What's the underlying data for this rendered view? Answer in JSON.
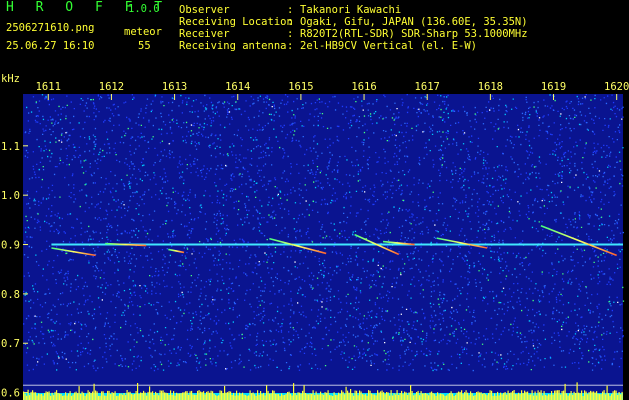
{
  "header": {
    "app_name": "H R O F F T",
    "version": "1.0.0",
    "filename": "2506271610.png",
    "datetime": "25.06.27 16:10",
    "meteor_label": "meteor",
    "meteor_count": "55",
    "info": [
      {
        "label": "Observer",
        "value": "Takanori Kawachi"
      },
      {
        "label": "Receiving Location",
        "value": "Ogaki, Gifu, JAPAN (136.60E, 35.35N)"
      },
      {
        "label": "Receiver",
        "value": "R820T2(RTL-SDR) SDR-Sharp 53.1000MHz"
      },
      {
        "label": "Receiving antenna",
        "value": "2el-HB9CV Vertical (el. E-W)"
      }
    ],
    "separator": ":"
  },
  "chart_data": {
    "type": "heatmap",
    "ylabel": "kHz",
    "x_ticks": [
      "1611",
      "1612",
      "1613",
      "1614",
      "1615",
      "1616",
      "1617",
      "1618",
      "1619",
      "1620"
    ],
    "y_ticks": [
      "1.1",
      "1.0",
      "0.9",
      "0.8",
      "0.7",
      "0.6"
    ],
    "xlim": [
      1610.6,
      1620.1
    ],
    "ylim": [
      0.585,
      1.205
    ],
    "carrier_khz": 0.9,
    "meteor_echoes": [
      {
        "t0": 1611.05,
        "f0": 0.893,
        "t1": 1611.75,
        "f1": 0.878
      },
      {
        "t0": 1611.9,
        "f0": 0.902,
        "t1": 1612.55,
        "f1": 0.898
      },
      {
        "t0": 1612.9,
        "f0": 0.89,
        "t1": 1613.15,
        "f1": 0.884
      },
      {
        "t0": 1614.5,
        "f0": 0.912,
        "t1": 1615.4,
        "f1": 0.882
      },
      {
        "t0": 1615.85,
        "f0": 0.92,
        "t1": 1616.55,
        "f1": 0.88
      },
      {
        "t0": 1616.3,
        "f0": 0.906,
        "t1": 1616.8,
        "f1": 0.9
      },
      {
        "t0": 1617.15,
        "f0": 0.913,
        "t1": 1617.95,
        "f1": 0.893
      },
      {
        "t0": 1618.8,
        "f0": 0.938,
        "t1": 1620.0,
        "f1": 0.878
      }
    ],
    "colors": {
      "background": "#0a1490",
      "noise": [
        "#1e3cff",
        "#2a6cff",
        "#00c8ff",
        "#40ff80",
        "#ffffff"
      ],
      "carrier": "#40e8ff",
      "echo": [
        "#40ff80",
        "#ffff60",
        "#ff6030"
      ],
      "activity": "#ffff33",
      "activity_base": "#00e0ff",
      "axis_text": "#ffff66",
      "grid_line": "#ffffff"
    }
  }
}
